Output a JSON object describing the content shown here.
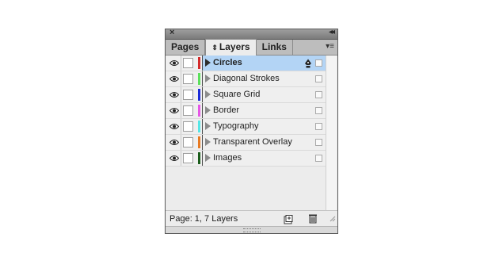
{
  "panel": {
    "close_glyph": "×",
    "collapse_glyph": "◂◂",
    "menu_glyph": "▾≡"
  },
  "tabs": [
    {
      "label": "Pages",
      "active": false
    },
    {
      "label": "Layers",
      "active": true,
      "prefix": "⇕"
    },
    {
      "label": "Links",
      "active": false
    }
  ],
  "layers": [
    {
      "name": "Circles",
      "color": "#d42a2a",
      "selected": true,
      "editing": true
    },
    {
      "name": "Diagonal Strokes",
      "color": "#5be05b",
      "selected": false
    },
    {
      "name": "Square Grid",
      "color": "#1a2ad8",
      "selected": false
    },
    {
      "name": "Border",
      "color": "#e656e6",
      "selected": false
    },
    {
      "name": "Typography",
      "color": "#55e6e6",
      "selected": false
    },
    {
      "name": "Transparent Overlay",
      "color": "#e87a22",
      "selected": false
    },
    {
      "name": "Images",
      "color": "#1a5c1a",
      "selected": false
    }
  ],
  "status": {
    "text": "Page: 1, 7 Layers"
  },
  "icons": {
    "eye": "eye-icon",
    "pen": "pen-icon",
    "new_layer": "new-layer-icon",
    "trash": "trash-icon",
    "resize": "resize-grip-icon"
  }
}
